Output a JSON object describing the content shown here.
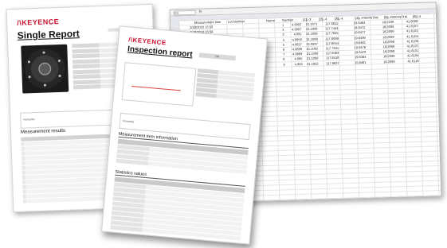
{
  "single_report": {
    "logo": "KEYENCE",
    "title": "Single Report",
    "section_results": "Measurement results",
    "remarks_label": "Remarks"
  },
  "spreadsheet": {
    "cell_ref": "D29",
    "fx": "fx",
    "headers": [
      "Measurement time",
      "Lot Number",
      "Name",
      "Number",
      "[1]L-3",
      "[2]L-4",
      "[3]L-4",
      "[4]L-P3SYNTHK",
      "[5]L-R3SYNTHK",
      "[6]L-4"
    ],
    "rows": [
      {
        "time": "2/18/2010 15:53",
        "number": "1",
        "values": [
          "4.9952",
          "21.1071",
          "117.6811",
          "19.6464",
          "18.2199",
          "41.6099"
        ]
      },
      {
        "time": "2/18/2010 15:54",
        "number": "2",
        "values": [
          "4.9907",
          "21.1099",
          "117.7444",
          "19.6472",
          "18.2099",
          "41.6107"
        ]
      },
      {
        "time": "",
        "number": "3",
        "values": [
          "4.991",
          "21.1099",
          "117.7645",
          "19.6477",
          "18.2099",
          "41.6102"
        ]
      },
      {
        "time": "",
        "number": "4",
        "values": [
          "4.9959",
          "21.1099",
          "117.8099",
          "19.6499",
          "18.2099",
          "41.6104"
        ]
      },
      {
        "time": "",
        "number": "5",
        "values": [
          "4.9927",
          "21.0947",
          "117.8044",
          "19.6481",
          "18.2099",
          "41.6106"
        ]
      },
      {
        "time": "",
        "number": "6",
        "values": [
          "4.9899",
          "21.1092",
          "117.7941",
          "19.6476",
          "18.2099",
          "41.6107"
        ]
      },
      {
        "time": "",
        "number": "7",
        "values": [
          "4.9889",
          "21.1099",
          "117.8463",
          "19.6470",
          "18.2099",
          "41.6101"
        ]
      },
      {
        "time": "",
        "number": "8",
        "values": [
          "4.995",
          "21.1099",
          "117.8418",
          "19.6464",
          "18.2099",
          "41.6104"
        ]
      },
      {
        "time": "",
        "number": "9",
        "values": [
          "4.993",
          "21.1052",
          "117.8627",
          "19.6461",
          "18.2099",
          "41.6118"
        ]
      }
    ]
  },
  "inspection_report": {
    "logo": "KEYENCE",
    "title": "Inspection report",
    "status": "OK",
    "remarks_label": "Remarks",
    "section_items": "Measurement item information",
    "section_stats": "Statistics values"
  }
}
